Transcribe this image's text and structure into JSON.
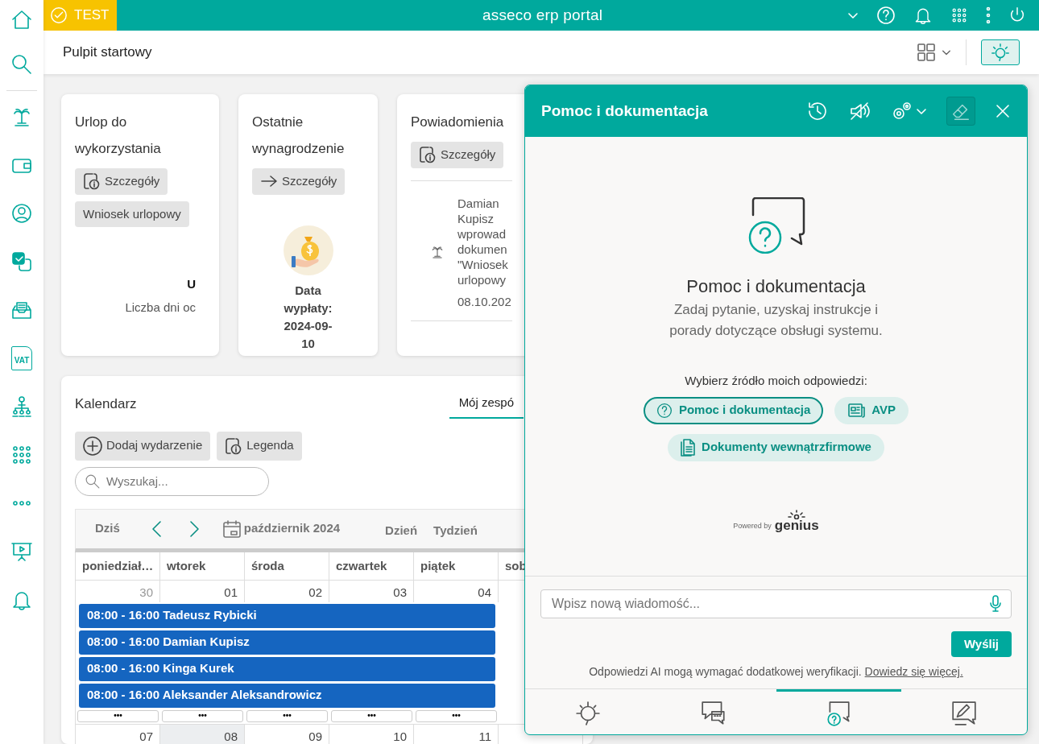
{
  "topbar": {
    "badge": "TEST",
    "title": "asseco erp portal"
  },
  "sidebar": {
    "vat_label": "VAT"
  },
  "page_title": "Pulpit startowy",
  "assistant_toggle": {
    "selected": true
  },
  "leave_card": {
    "title": "Urlop do wykorzystania",
    "buttons": [
      "Szczegóły",
      "Wniosek urlopowy"
    ],
    "value": "U",
    "caption": "Liczba dni oc"
  },
  "salary_card": {
    "title": "Ostatnie wynagrodzenie",
    "button": "Szczegóły",
    "payout": "Data wypłaty: 2024-09-10"
  },
  "notifications_card": {
    "title": "Powiadomienia",
    "button": "Szczegóły",
    "items": [
      {
        "lines": [
          "Damian",
          "Kupisz",
          "wprowad",
          "dokumen",
          "\"Wniosek",
          "urlopowy"
        ],
        "date": "08.10.202"
      }
    ]
  },
  "calendar": {
    "title": "Kalendarz",
    "tabs": [
      {
        "label": "Mój zespó",
        "selected": true
      }
    ],
    "buttons": [
      "Dodaj wydarzenie",
      "Legenda"
    ],
    "search": {
      "placeholder": "Wyszukaj..."
    },
    "today_button": "Dziś",
    "month": "październik 2024",
    "views": [
      {
        "label": "Dzień",
        "selected": false
      },
      {
        "label": "Tydzień",
        "selected": false
      }
    ],
    "weekdays": [
      "poniedział…",
      "wtorek",
      "środa",
      "czwartek",
      "piątek",
      "sob"
    ],
    "weeks": [
      {
        "days": [
          {
            "number": "30",
            "other_month": true,
            "today": false
          },
          {
            "number": "01",
            "other_month": false,
            "today": false
          },
          {
            "number": "02",
            "other_month": false,
            "today": false
          },
          {
            "number": "03",
            "other_month": false,
            "today": false
          },
          {
            "number": "04",
            "other_month": false,
            "today": false
          }
        ],
        "events": [
          "08:00 - 16:00 Tadeusz Rybicki",
          "08:00 - 16:00 Damian Kupisz",
          "08:00 - 16:00 Kinga Kurek",
          "08:00 - 16:00 Aleksander Aleksandrowicz"
        ],
        "more": [
          "•••",
          "•••",
          "•••",
          "•••",
          "•••"
        ]
      },
      {
        "days": [
          {
            "number": "07",
            "other_month": false,
            "today": false
          },
          {
            "number": "08",
            "other_month": false,
            "today": true
          },
          {
            "number": "09",
            "other_month": false,
            "today": false
          },
          {
            "number": "10",
            "other_month": false,
            "today": false
          },
          {
            "number": "11",
            "other_month": false,
            "today": false
          }
        ]
      }
    ]
  },
  "assistant": {
    "title": "Pomoc i dokumentacja",
    "clear_active": true,
    "heading": "Pomoc i dokumentacja",
    "text": "Zadaj pytanie, uzyskaj instrukcje i porady dotyczące obsługi systemu.",
    "prompt": "Wybierz źródło moich odpowiedzi:",
    "sources": [
      {
        "kind": "help",
        "label": "Pomoc i dokumentacja",
        "selected": true
      },
      {
        "kind": "news",
        "label": "AVP",
        "selected": false
      },
      {
        "kind": "docs",
        "label": "Dokumenty wewnątrzfirmowe",
        "selected": false
      }
    ],
    "powered_by": "Powered by",
    "brand": "genius",
    "message": {
      "placeholder": "Wpisz nową wiadomość..."
    },
    "send": "Wyślij",
    "disclaimer": "Odpowiedzi AI mogą wymagać dodatkowej weryfikacji.",
    "link": "Dowiedz się więcej.",
    "bottom_tabs": [
      {
        "kind": "tips",
        "selected": false
      },
      {
        "kind": "chat",
        "selected": false
      },
      {
        "kind": "help",
        "selected": true
      },
      {
        "kind": "edit",
        "selected": false
      }
    ]
  }
}
